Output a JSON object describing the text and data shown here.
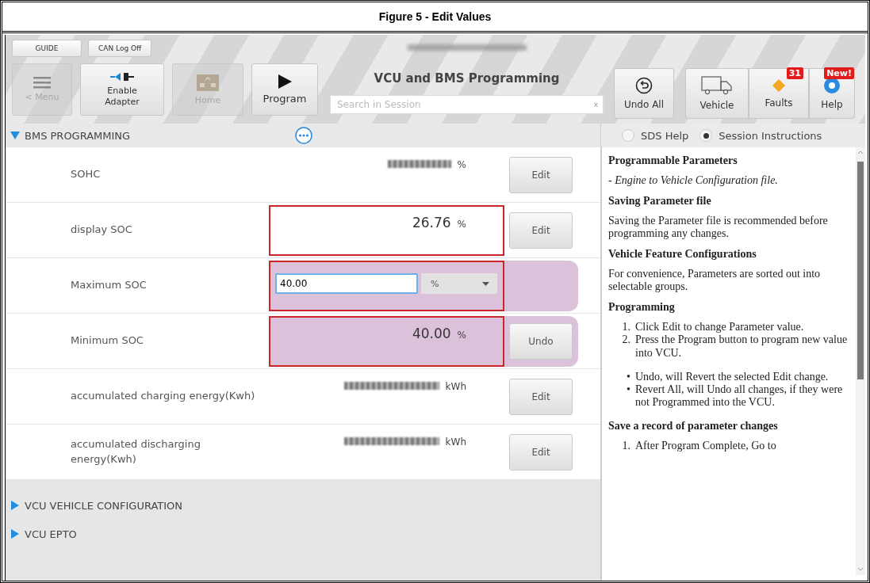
{
  "figure_title": "Figure 5 - Edit Values",
  "toolbar": {
    "top_buttons": [
      "GUIDE",
      "CAN Log Off"
    ],
    "nav_buttons": [
      {
        "label": "< Menu",
        "kind": "menu",
        "disabled": true
      },
      {
        "label": "Enable Adapter",
        "kind": "plug",
        "disabled": false
      },
      {
        "label": "Home",
        "kind": "home",
        "disabled": true
      },
      {
        "label": "Program",
        "kind": "play",
        "disabled": false
      }
    ],
    "title": "VCU and BMS Programming",
    "search": {
      "placeholder": "Search in Session",
      "clear": "x"
    },
    "undo_button": {
      "label": "Undo All"
    },
    "group_buttons": [
      {
        "label": "Vehicle",
        "kind": "truck"
      },
      {
        "label": "Faults",
        "kind": "diamond",
        "badge": "31"
      },
      {
        "label": "Help",
        "kind": "help",
        "badge": "New!"
      }
    ]
  },
  "sections": [
    {
      "title": "BMS PROGRAMMING",
      "expanded": true,
      "rows": [
        {
          "label": "SOHC",
          "kind": "value",
          "blurred": true,
          "unit": "%",
          "button": "Edit",
          "highlighted": false,
          "changed": false
        },
        {
          "label": "display SOC",
          "kind": "value",
          "value": "26.76",
          "unit": "%",
          "button": "Edit",
          "highlighted": true,
          "changed": false
        },
        {
          "label": "Maximum SOC",
          "kind": "editing",
          "value": "40.00",
          "unit": "%",
          "highlighted": true,
          "changed": true
        },
        {
          "label": "Minimum SOC",
          "kind": "value",
          "value": "40.00",
          "unit": "%",
          "button": "Undo",
          "highlighted": true,
          "changed": true
        },
        {
          "label": "accumulated charging energy(Kwh)",
          "kind": "value",
          "blurred": true,
          "unit": "kWh",
          "button": "Edit",
          "highlighted": false,
          "changed": false
        },
        {
          "label": "accumulated discharging energy(Kwh)",
          "kind": "value",
          "blurred": true,
          "unit": "kWh",
          "button": "Edit",
          "highlighted": false,
          "changed": false
        }
      ]
    },
    {
      "title": "VCU VEHICLE CONFIGURATION",
      "expanded": false
    },
    {
      "title": "VCU EPTO",
      "expanded": false
    }
  ],
  "help_pane": {
    "options": [
      {
        "label": "SDS Help",
        "selected": false
      },
      {
        "label": "Session Instructions",
        "selected": true
      }
    ],
    "content": [
      {
        "kind": "heading",
        "text": "Programmable Parameters"
      },
      {
        "kind": "note",
        "text": "- Engine to Vehicle Configuration file."
      },
      {
        "kind": "heading",
        "text": "Saving Parameter file"
      },
      {
        "kind": "paragraph",
        "text": "Saving the Parameter file is recommended before programming any changes."
      },
      {
        "kind": "heading",
        "text": "Vehicle Feature Configurations"
      },
      {
        "kind": "paragraph",
        "text": "For convenience, Parameters are sorted out into selectable groups."
      },
      {
        "kind": "heading",
        "text": "Programming"
      },
      {
        "kind": "list",
        "items": [
          {
            "marker": "1.",
            "text": "Click Edit to change Parameter value."
          },
          {
            "marker": "2.",
            "text": "Press the Program button to program new value into VCU."
          }
        ]
      },
      {
        "kind": "list",
        "items": [
          {
            "marker": "•",
            "text": "Undo, will Revert the selected Edit change."
          },
          {
            "marker": "•",
            "text": "Revert All, will Undo all changes, if they were not Programmed into the VCU."
          }
        ]
      },
      {
        "kind": "heading",
        "text": "Save a record of parameter changes"
      },
      {
        "kind": "list",
        "items": [
          {
            "marker": "1.",
            "text": "After Program Complete, Go to"
          }
        ]
      }
    ]
  }
}
